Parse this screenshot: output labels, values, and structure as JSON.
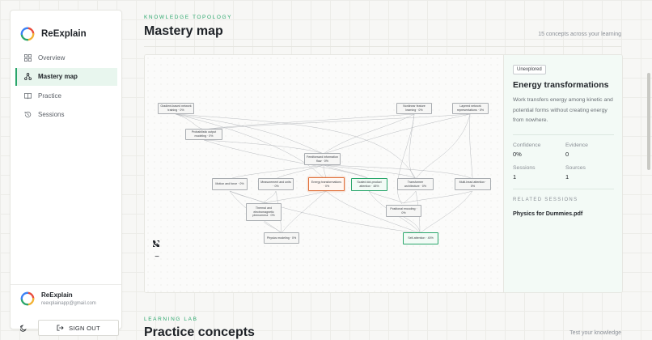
{
  "brand": {
    "name": "ReExplain",
    "logo_icon": "reexplain-logo-icon",
    "colors": [
      "#e94b3c",
      "#f2b233",
      "#2aa66b",
      "#3b82f6"
    ]
  },
  "nav": {
    "items": [
      {
        "label": "Overview",
        "icon": "grid-icon",
        "active": false
      },
      {
        "label": "Mastery map",
        "icon": "network-icon",
        "active": true
      },
      {
        "label": "Practice",
        "icon": "book-icon",
        "active": false
      },
      {
        "label": "Sessions",
        "icon": "history-icon",
        "active": false
      }
    ]
  },
  "user": {
    "name": "ReExplain",
    "email": "reexplainapp@gmail.com"
  },
  "signout_label": "SIGN OUT",
  "header": {
    "eyebrow": "KNOWLEDGE TOPOLOGY",
    "title": "Mastery map",
    "summary": "15 concepts across your learning"
  },
  "graph": {
    "nodes": [
      {
        "id": "gradient",
        "label": "Gradient-based network training · 0%",
        "state": "default"
      },
      {
        "id": "nonlinear",
        "label": "Nonlinear feature learning · 0%",
        "state": "default"
      },
      {
        "id": "layered",
        "label": "Layered network representations · 0%",
        "state": "default"
      },
      {
        "id": "prob",
        "label": "Probabilistic output modeling · 0%",
        "state": "default"
      },
      {
        "id": "feed",
        "label": "Feedforward information flow · 0%",
        "state": "default"
      },
      {
        "id": "motion",
        "label": "Motion and force · 0%",
        "state": "default"
      },
      {
        "id": "measure",
        "label": "Measurement and units · 0%",
        "state": "default"
      },
      {
        "id": "energy",
        "label": "Energy transformations · 0%",
        "state": "selected"
      },
      {
        "id": "scaled",
        "label": "Scaled dot-product attention · 48%",
        "state": "mastered"
      },
      {
        "id": "transformer",
        "label": "Transformer architecture · 0%",
        "state": "default"
      },
      {
        "id": "multi",
        "label": "Multi-head attention · 0%",
        "state": "default"
      },
      {
        "id": "thermal",
        "label": "Thermal and electromagnetic phenomena · 0%",
        "state": "default"
      },
      {
        "id": "positional",
        "label": "Positional encoding · 0%",
        "state": "default"
      },
      {
        "id": "physics",
        "label": "Physics modeling · 0%",
        "state": "default"
      },
      {
        "id": "self",
        "label": "Self-attention · 40%",
        "state": "mastered"
      }
    ],
    "controls": [
      {
        "name": "zoom-in-button",
        "glyph": "+"
      },
      {
        "name": "zoom-out-button",
        "glyph": "−"
      },
      {
        "name": "fit-view-button",
        "glyph": "⛶"
      },
      {
        "name": "lock-button",
        "glyph": "☎"
      }
    ]
  },
  "details": {
    "status": "Unexplored",
    "title": "Energy transformations",
    "description": "Work transfers energy among kinetic and potential forms without creating energy from nowhere.",
    "stats": [
      {
        "label": "Confidence",
        "value": "0%"
      },
      {
        "label": "Evidence",
        "value": "0"
      },
      {
        "label": "Sessions",
        "value": "1"
      },
      {
        "label": "Sources",
        "value": "1"
      }
    ],
    "related_label": "RELATED SESSIONS",
    "related": [
      "Physics for Dummies.pdf"
    ]
  },
  "next_section": {
    "eyebrow": "LEARNING LAB",
    "title": "Practice concepts",
    "summary": "Test your knowledge"
  }
}
